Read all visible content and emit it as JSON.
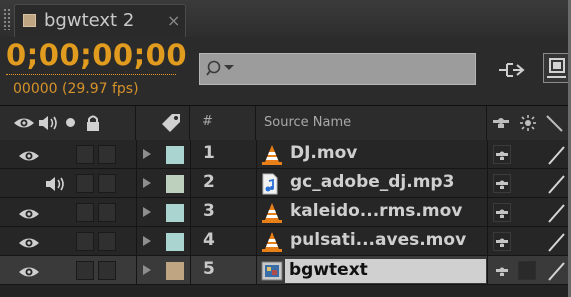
{
  "tab": {
    "title": "bgwtext 2",
    "close_glyph": "×",
    "swatch_color": "#bfa582"
  },
  "toolbar": {
    "timecode": "0;00;00;00",
    "frame_fps": "00000 (29.97 fps)",
    "search": {
      "value": "",
      "placeholder": ""
    },
    "icons": [
      "search-icon",
      "comp-mini-flowchart-icon",
      "live-update-icon"
    ]
  },
  "columns": {
    "av": [
      "eye-icon",
      "speaker-icon",
      "solo-dot-icon",
      "lock-icon"
    ],
    "label_header_icon": "label-tag-icon",
    "number": "#",
    "source_name": "Source Name",
    "switches": [
      "shy-icon",
      "collapse-icon",
      "quality-icon"
    ]
  },
  "layers": [
    {
      "number": "1",
      "name": "DJ.mov",
      "label_color": "#a9d4d0",
      "type": "video",
      "video": true,
      "audio": false,
      "selected": false
    },
    {
      "number": "2",
      "name": "gc_adobe_dj.mp3",
      "label_color": "#bcd0bd",
      "type": "audio",
      "video": false,
      "audio": true,
      "selected": false
    },
    {
      "number": "3",
      "name": "kaleido...rms.mov",
      "label_color": "#a9d4d0",
      "type": "video",
      "video": true,
      "audio": false,
      "selected": false
    },
    {
      "number": "4",
      "name": "pulsati...aves.mov",
      "label_color": "#a9d4d0",
      "type": "video",
      "video": true,
      "audio": false,
      "selected": false
    },
    {
      "number": "5",
      "name": "bgwtext",
      "label_color": "#bfa582",
      "type": "composition",
      "video": true,
      "audio": false,
      "selected": true
    }
  ],
  "colors": {
    "timecode": "#e19b1e",
    "panel_bg": "#232323",
    "vlc_orange": "#e8801a"
  }
}
